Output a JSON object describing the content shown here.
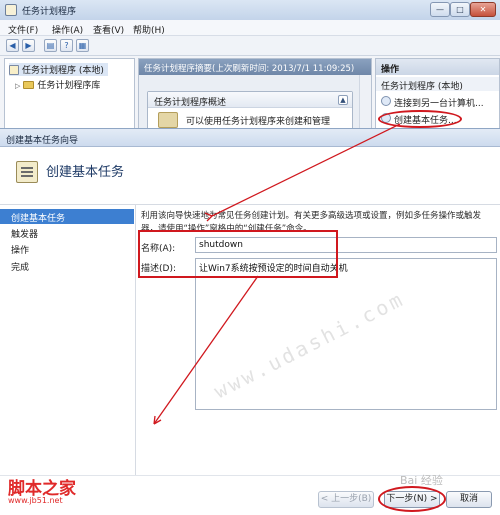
{
  "main_window": {
    "title": "任务计划程序",
    "controls": {
      "minimize": "—",
      "maximize": "□",
      "close": "✕"
    },
    "menu": [
      "文件(F)",
      "操作(A)",
      "查看(V)",
      "帮助(H)"
    ],
    "toolbar": [
      "◀",
      "▶",
      "▤",
      "?",
      "▦"
    ],
    "tree": [
      {
        "label": "任务计划程序 (本地)"
      },
      {
        "label": "任务计划程序库"
      }
    ],
    "summary_header": "任务计划程序摘要(上次刷新时间: 2013/7/1 11:09:25)",
    "overview": {
      "title": "任务计划程序概述",
      "text": "可以使用任务计划程序来创建和管理",
      "toggle": "▲"
    },
    "actions": {
      "header": "操作",
      "group": "任务计划程序 (本地)",
      "items": [
        "连接到另一台计算机...",
        "创建基本任务..."
      ]
    }
  },
  "wizard": {
    "title": "创建基本任务向导",
    "header_title": "创建基本任务",
    "steps": [
      "创建基本任务",
      "触发器",
      "操作",
      "完成"
    ],
    "active_step": 0,
    "description": "利用该向导快速地为常见任务创建计划。有关更多高级选项或设置，例如多任务操作或触发器，请使用“操作”窗格中的“创建任务”命令。",
    "name_label": "名称(A):",
    "name_value": "shutdown",
    "desc_label": "描述(D):",
    "desc_value": "让Win7系统按预设定的时间自动关机",
    "buttons": {
      "back": "< 上一步(B)",
      "next": "下一步(N) >",
      "cancel": "取消"
    }
  },
  "watermarks": {
    "site": "www.udashi.com",
    "logo_cn": "脚本之家",
    "logo_url": "www.jb51.net",
    "baidu": "Bai 经验"
  },
  "colors": {
    "annotation": "#d0181e",
    "selected_step": "#3d7fd1"
  }
}
